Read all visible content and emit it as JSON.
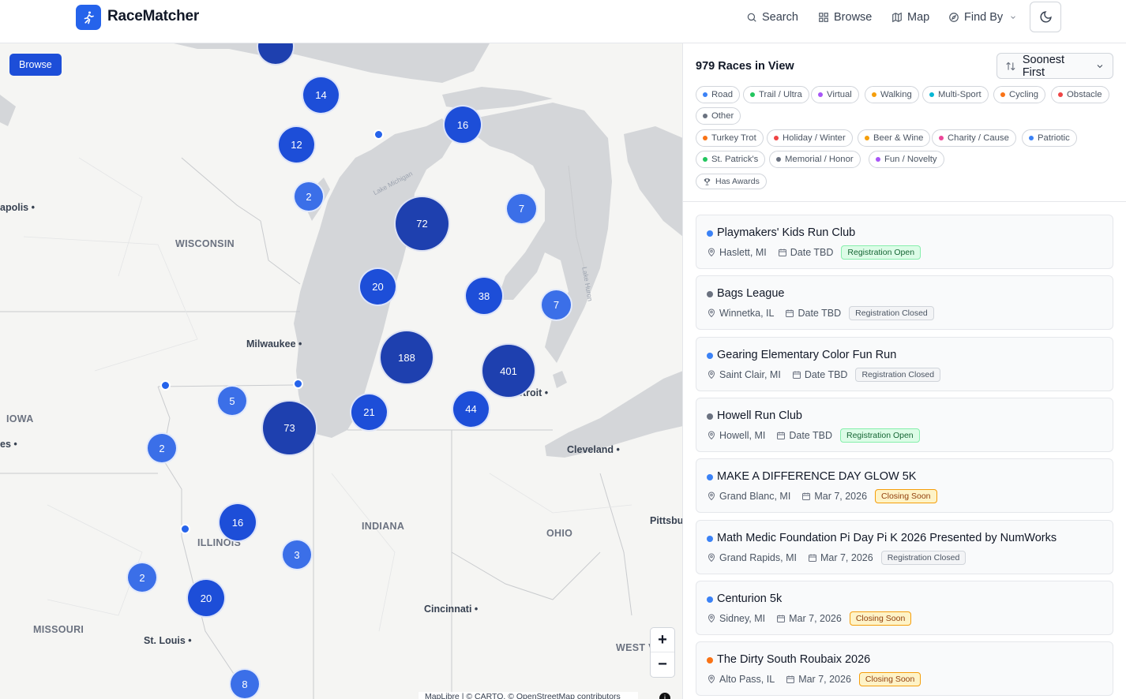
{
  "app": {
    "name": "RaceMatcher"
  },
  "nav": {
    "search": "Search",
    "browse": "Browse",
    "map": "Map",
    "find_by": "Find By"
  },
  "map": {
    "browse_button": "Browse",
    "state_labels": [
      "WISCONSIN",
      "IOWA",
      "ILLINOIS",
      "INDIANA",
      "OHIO",
      "MISSOURI",
      "WEST V"
    ],
    "city_labels": [
      "apolis",
      "Milwaukee",
      "etroit",
      "Cleveland",
      "Pittsbu",
      "Cincinnati",
      "St. Louis",
      "es"
    ],
    "lake_labels": [
      "Lake Michigan",
      "Lake Huron"
    ],
    "clusters": [
      "14",
      "12",
      "16",
      "2",
      "72",
      "7",
      "20",
      "38",
      "7",
      "188",
      "401",
      "5",
      "21",
      "44",
      "73",
      "2",
      "16",
      "3",
      "2",
      "20",
      "8"
    ],
    "zoom_in": "+",
    "zoom_out": "−",
    "attribution": "MapLibre | © CARTO, © OpenStreetMap contributors",
    "attribution_icon": "i"
  },
  "panel": {
    "count_label": "979 Races in View",
    "sort_label": "Soonest First",
    "categories": [
      {
        "label": "Road",
        "color": "#3b82f6"
      },
      {
        "label": "Trail / Ultra",
        "color": "#22c55e"
      },
      {
        "label": "Virtual",
        "color": "#a855f7"
      },
      {
        "label": "Walking",
        "color": "#f59e0b"
      },
      {
        "label": "Multi-Sport",
        "color": "#06b6d4"
      },
      {
        "label": "Cycling",
        "color": "#f97316"
      },
      {
        "label": "Obstacle",
        "color": "#ef4444"
      },
      {
        "label": "Other",
        "color": "#6b7280"
      }
    ],
    "themes": [
      {
        "label": "Turkey Trot",
        "color": "#f97316"
      },
      {
        "label": "Holiday / Winter",
        "color": "#ef4444"
      },
      {
        "label": "Beer & Wine",
        "color": "#f59e0b"
      },
      {
        "label": "Charity / Cause",
        "color": "#ec4899"
      },
      {
        "label": "Patriotic",
        "color": "#3b82f6"
      },
      {
        "label": "St. Patrick's",
        "color": "#22c55e"
      },
      {
        "label": "Memorial / Honor",
        "color": "#6b7280"
      },
      {
        "label": "Fun / Novelty",
        "color": "#a855f7"
      }
    ],
    "awards_chip": "Has Awards"
  },
  "races": [
    {
      "title": "Playmakers' Kids Run Club",
      "location": "Haslett, MI",
      "date": "Date TBD",
      "status": "Registration Open",
      "status_kind": "open",
      "dot": "#3b82f6"
    },
    {
      "title": "Bags League",
      "location": "Winnetka, IL",
      "date": "Date TBD",
      "status": "Registration Closed",
      "status_kind": "closed",
      "dot": "#6b7280"
    },
    {
      "title": "Gearing Elementary Color Fun Run",
      "location": "Saint Clair, MI",
      "date": "Date TBD",
      "status": "Registration Closed",
      "status_kind": "closed",
      "dot": "#3b82f6"
    },
    {
      "title": "Howell Run Club",
      "location": "Howell, MI",
      "date": "Date TBD",
      "status": "Registration Open",
      "status_kind": "open",
      "dot": "#6b7280"
    },
    {
      "title": "MAKE A DIFFERENCE DAY GLOW 5K",
      "location": "Grand Blanc, MI",
      "date": "Mar 7, 2026",
      "status": "Closing Soon",
      "status_kind": "soon",
      "dot": "#3b82f6"
    },
    {
      "title": "Math Medic Foundation Pi Day Pi K 2026 Presented by NumWorks",
      "location": "Grand Rapids, MI",
      "date": "Mar 7, 2026",
      "status": "Registration Closed",
      "status_kind": "closed",
      "dot": "#3b82f6"
    },
    {
      "title": "Centurion 5k",
      "location": "Sidney, MI",
      "date": "Mar 7, 2026",
      "status": "Closing Soon",
      "status_kind": "soon",
      "dot": "#3b82f6"
    },
    {
      "title": "The Dirty South Roubaix 2026",
      "location": "Alto Pass, IL",
      "date": "Mar 7, 2026",
      "status": "Closing Soon",
      "status_kind": "soon",
      "dot": "#f97316"
    }
  ]
}
